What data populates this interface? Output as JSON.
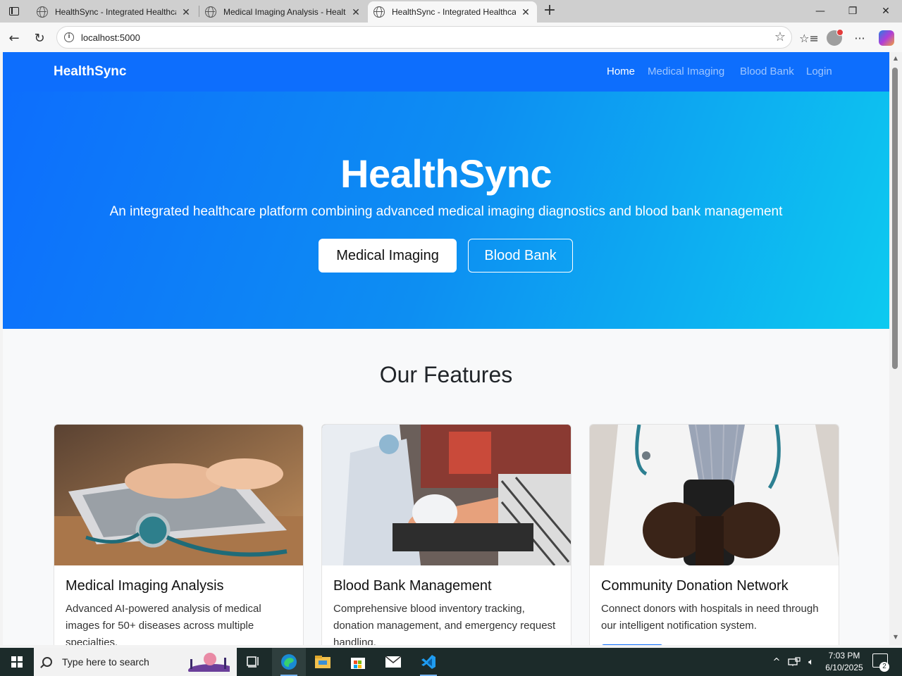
{
  "browser": {
    "tabs": [
      {
        "title": "HealthSync - Integrated Healthcare",
        "active": false
      },
      {
        "title": "Medical Imaging Analysis - HealthSync",
        "active": false
      },
      {
        "title": "HealthSync - Integrated Healthcare",
        "active": true
      }
    ],
    "url": "localhost:5000"
  },
  "site": {
    "brand": "HealthSync",
    "nav": [
      "Home",
      "Medical Imaging",
      "Blood Bank",
      "Login"
    ],
    "hero": {
      "title": "HealthSync",
      "subtitle": "An integrated healthcare platform combining advanced medical imaging diagnostics and blood bank management",
      "primary_button": "Medical Imaging",
      "secondary_button": "Blood Bank"
    },
    "features_title": "Our Features",
    "cards": [
      {
        "title": "Medical Imaging Analysis",
        "text": "Advanced AI-powered analysis of medical images for 50+ diseases across multiple specialties."
      },
      {
        "title": "Blood Bank Management",
        "text": "Comprehensive blood inventory tracking, donation management, and emergency request handling."
      },
      {
        "title": "Community Donation Network",
        "text": "Connect donors with hospitals in need through our intelligent notification system."
      }
    ]
  },
  "taskbar": {
    "search_placeholder": "Type here to search",
    "time": "7:03 PM",
    "date": "6/10/2025",
    "notification_count": "2"
  },
  "colors": {
    "primary": "#0d6efd",
    "hero_gradient_end": "#0dcaf0"
  }
}
